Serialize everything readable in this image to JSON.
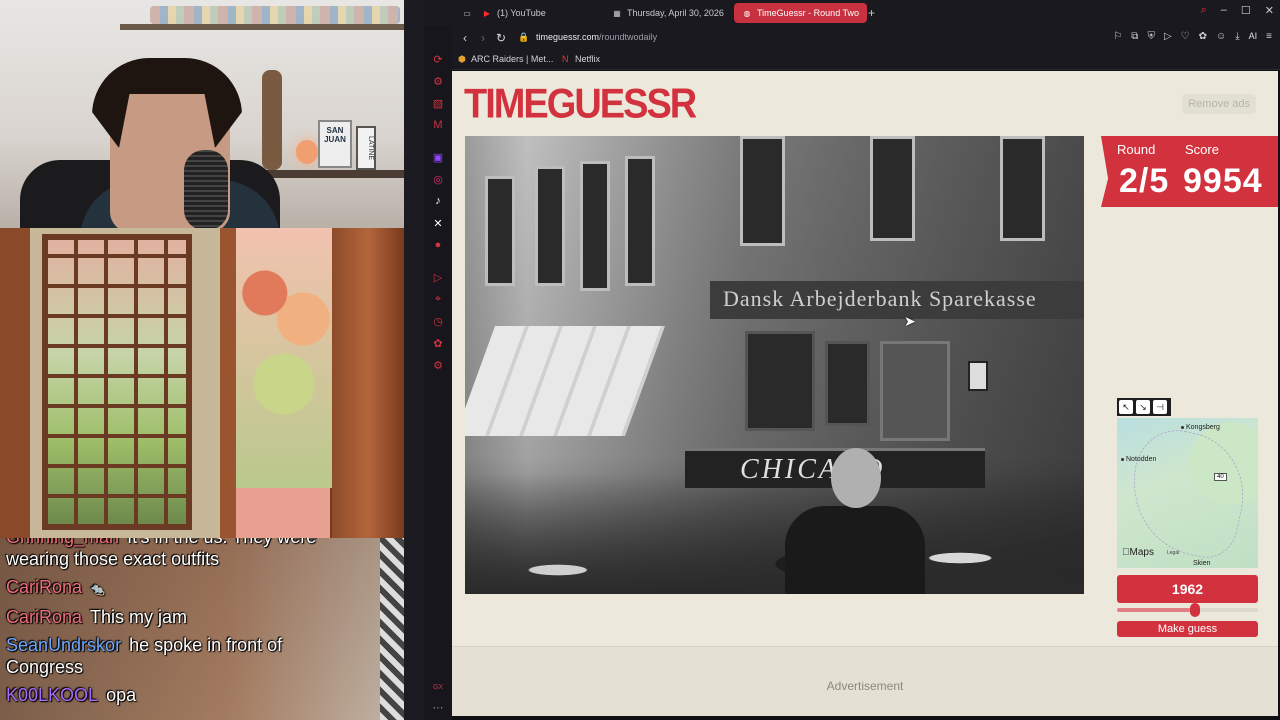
{
  "browser": {
    "tabs": [
      {
        "label": "(1) YouTube",
        "icon": "youtube-icon"
      },
      {
        "label": "Thursday, April 30, 2026",
        "icon": "calendar-icon"
      },
      {
        "label": "TimeGuessr - Round Two",
        "icon": "globe-icon",
        "active": true
      }
    ],
    "url_domain": "timeguessr.com",
    "url_path": "/roundtwodaily",
    "ai_label": "AI",
    "bookmarks": [
      {
        "label": "ARC Raiders | Met...",
        "icon": "arc-icon"
      },
      {
        "label": "Netflix",
        "icon": "netflix-icon"
      }
    ]
  },
  "webcam": {
    "plate_text": "SAN JUAN",
    "plate2_text": "LATINE"
  },
  "chat": {
    "messages": [
      {
        "user": "Grinning_man",
        "text": "It's in the us. They were wearing those exact outfits",
        "color": "#f06c7b"
      },
      {
        "user": "CariRona",
        "text": "🐀",
        "color": "#f06c7b"
      },
      {
        "user": "CariRona",
        "text": "This my jam",
        "color": "#f06c7b"
      },
      {
        "user": "SeanUndrskor",
        "text": "he spoke in front of Congress",
        "color": "#6fa8ff"
      },
      {
        "user": "K00LKOOL",
        "text": "opa",
        "color": "#a86bff"
      }
    ]
  },
  "game": {
    "logo": "TIMEGUESSR",
    "remove_ads": "Remove ads",
    "round_label": "Round",
    "score_label": "Score",
    "round_value": "2/5",
    "score_value": "9954",
    "photo_sign": "Dansk Arbejderbank Sparekasse",
    "photo_sign2": "CHICAGO",
    "year": "1962",
    "slider_fraction": 0.55,
    "make_guess": "Make guess",
    "map": {
      "places": [
        "Kongsberg",
        "Notodden",
        "Skien"
      ],
      "road": "40",
      "brand": "Maps",
      "legal": "Legal"
    },
    "advertisement": "Advertisement"
  },
  "colors": {
    "accent": "#d2323e",
    "page_bg": "#ece9dc"
  }
}
